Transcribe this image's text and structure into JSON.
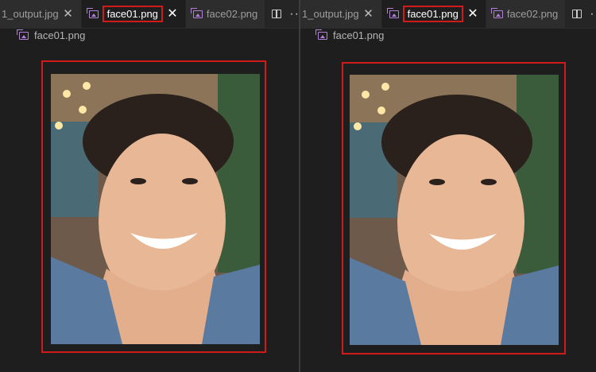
{
  "tabs": {
    "output": "1_output.jpg",
    "face01": "face01.png",
    "face02": "face02.png"
  },
  "breadcrumb": {
    "file": "face01.png"
  },
  "icons": {
    "image": "image-file-icon",
    "close": "close-icon",
    "split": "split-editor-icon",
    "more": "more-actions-icon"
  },
  "glyphs": {
    "close": "✕",
    "more": "···"
  },
  "colors": {
    "highlight": "#d11a1a",
    "image_icon": "#b180d7"
  }
}
